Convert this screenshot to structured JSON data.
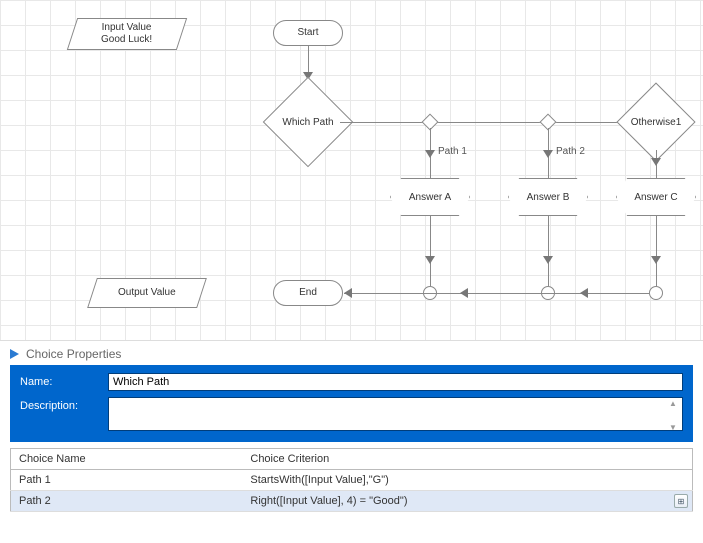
{
  "flow": {
    "input_label": "Input Value\nGood Luck!",
    "start": "Start",
    "decision": "Which Path",
    "otherwise": "Otherwise1",
    "path1": "Path 1",
    "path2": "Path 2",
    "answer_a": "Answer A",
    "answer_b": "Answer B",
    "answer_c": "Answer C",
    "end": "End",
    "output_label": "Output Value"
  },
  "panel": {
    "title": "Choice Properties",
    "name_label": "Name:",
    "name_value": "Which Path",
    "desc_label": "Description:",
    "desc_value": ""
  },
  "table": {
    "col_name": "Choice Name",
    "col_criterion": "Choice Criterion",
    "rows": [
      {
        "name": "Path 1",
        "criterion": "StartsWith([Input Value],\"G\")"
      },
      {
        "name": "Path 2",
        "criterion": "Right([Input Value], 4) = \"Good\")"
      }
    ],
    "selected_index": 1
  }
}
